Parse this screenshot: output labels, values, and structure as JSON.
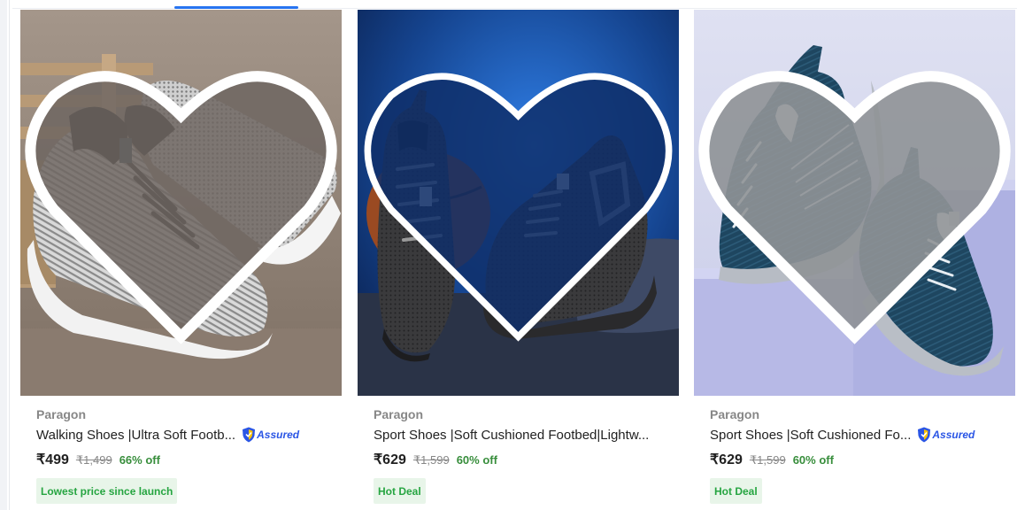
{
  "products": [
    {
      "brand": "Paragon",
      "title": "Walking Shoes |Ultra Soft Footb...",
      "assured": true,
      "assured_label": "Assured",
      "price": "₹499",
      "mrp": "₹1,499",
      "discount": "66% off",
      "badge": "Lowest price since launch",
      "image_icon": "shoe-photo-grey-knit"
    },
    {
      "brand": "Paragon",
      "title": "Sport Shoes |Soft Cushioned Footbed|Lightw...",
      "assured": false,
      "assured_label": "",
      "price": "₹629",
      "mrp": "₹1,599",
      "discount": "60% off",
      "badge": "Hot Deal",
      "image_icon": "shoe-photo-black-mesh"
    },
    {
      "brand": "Paragon",
      "title": "Sport Shoes |Soft Cushioned Fo...",
      "assured": true,
      "assured_label": "Assured",
      "price": "₹629",
      "mrp": "₹1,599",
      "discount": "60% off",
      "badge": "Hot Deal",
      "image_icon": "shoe-photo-navy-knit"
    }
  ],
  "colors": {
    "accent": "#2874f0",
    "discount_green": "#388e3c",
    "deal_bg": "#e8f5e9",
    "assured_blue": "#2a55e5"
  }
}
